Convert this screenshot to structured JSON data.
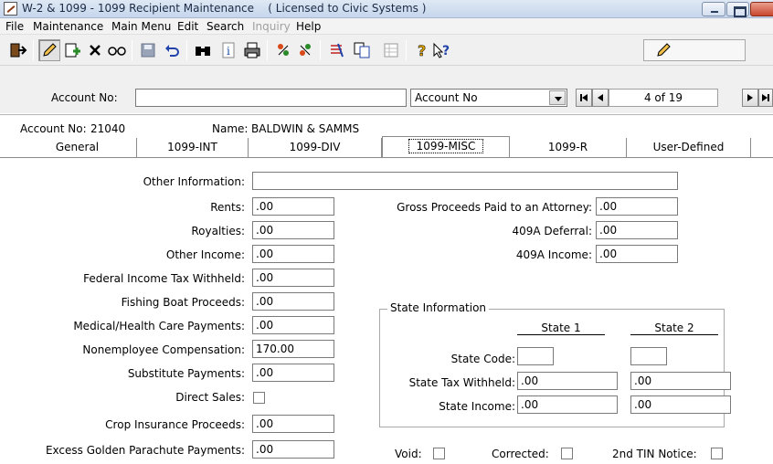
{
  "window": {
    "title": "W-2 & 1099 - 1099 Recipient Maintenance    ( Licensed to Civic Systems )"
  },
  "menu": [
    {
      "label": "File",
      "enabled": true
    },
    {
      "label": "Maintenance",
      "enabled": true
    },
    {
      "label": "Main Menu",
      "enabled": true
    },
    {
      "label": "Edit",
      "enabled": true
    },
    {
      "label": "Search",
      "enabled": true
    },
    {
      "label": "Inquiry",
      "enabled": false
    },
    {
      "label": "Help",
      "enabled": true
    }
  ],
  "toolbar": {
    "icons": [
      "exit-icon",
      "edit-pencil-icon",
      "add-record-icon",
      "delete-icon",
      "view-icon",
      "save-icon",
      "undo-icon",
      "find-icon",
      "info-icon",
      "print-icon",
      "import-icon",
      "export-icon",
      "list-icon",
      "copy-icon",
      "grid-icon",
      "help-icon",
      "context-help-icon",
      "edit-mode-icon"
    ]
  },
  "account_bar": {
    "label": "Account No:",
    "value": "",
    "sort_by": "Account No",
    "record_position": "4 of 19"
  },
  "header": {
    "account_label": "Account No:",
    "account_no": "21040",
    "name_label": "Name:",
    "name": "BALDWIN & SAMMS"
  },
  "tabs": [
    {
      "label": "General",
      "active": false
    },
    {
      "label": "1099-INT",
      "active": false
    },
    {
      "label": "1099-DIV",
      "active": false
    },
    {
      "label": "1099-MISC",
      "active": true
    },
    {
      "label": "1099-R",
      "active": false
    },
    {
      "label": "User-Defined",
      "active": false
    }
  ],
  "form": {
    "other_information": {
      "label": "Other Information:",
      "value": ""
    },
    "rents": {
      "label": "Rents:",
      "value": ".00"
    },
    "royalties": {
      "label": "Royalties:",
      "value": ".00"
    },
    "other_income": {
      "label": "Other Income:",
      "value": ".00"
    },
    "federal_tax_withheld": {
      "label": "Federal Income Tax Withheld:",
      "value": ".00"
    },
    "fishing_boat": {
      "label": "Fishing Boat Proceeds:",
      "value": ".00"
    },
    "medical": {
      "label": "Medical/Health Care Payments:",
      "value": ".00"
    },
    "nonemployee": {
      "label": "Nonemployee Compensation:",
      "value": "170.00"
    },
    "substitute": {
      "label": "Substitute Payments:",
      "value": ".00"
    },
    "direct_sales": {
      "label": "Direct Sales:",
      "checked": false
    },
    "crop_insurance": {
      "label": "Crop Insurance Proceeds:",
      "value": ".00"
    },
    "golden_parachute": {
      "label": "Excess Golden Parachute Payments:",
      "value": ".00"
    },
    "attorney": {
      "label": "Gross Proceeds Paid to an Attorney:",
      "value": ".00"
    },
    "deferral_409a": {
      "label": "409A Deferral:",
      "value": ".00"
    },
    "income_409a": {
      "label": "409A Income:",
      "value": ".00"
    }
  },
  "state_info": {
    "title": "State Information",
    "state1_header": "State 1",
    "state2_header": "State 2",
    "code_label": "State Code:",
    "withheld_label": "State Tax Withheld:",
    "income_label": "State Income:",
    "state1": {
      "code": "",
      "withheld": ".00",
      "income": ".00"
    },
    "state2": {
      "code": "",
      "withheld": ".00",
      "income": ".00"
    }
  },
  "flags": {
    "void": {
      "label": "Void:",
      "checked": false
    },
    "corrected": {
      "label": "Corrected:",
      "checked": false
    },
    "tin_notice": {
      "label": "2nd TIN Notice:",
      "checked": false
    }
  }
}
